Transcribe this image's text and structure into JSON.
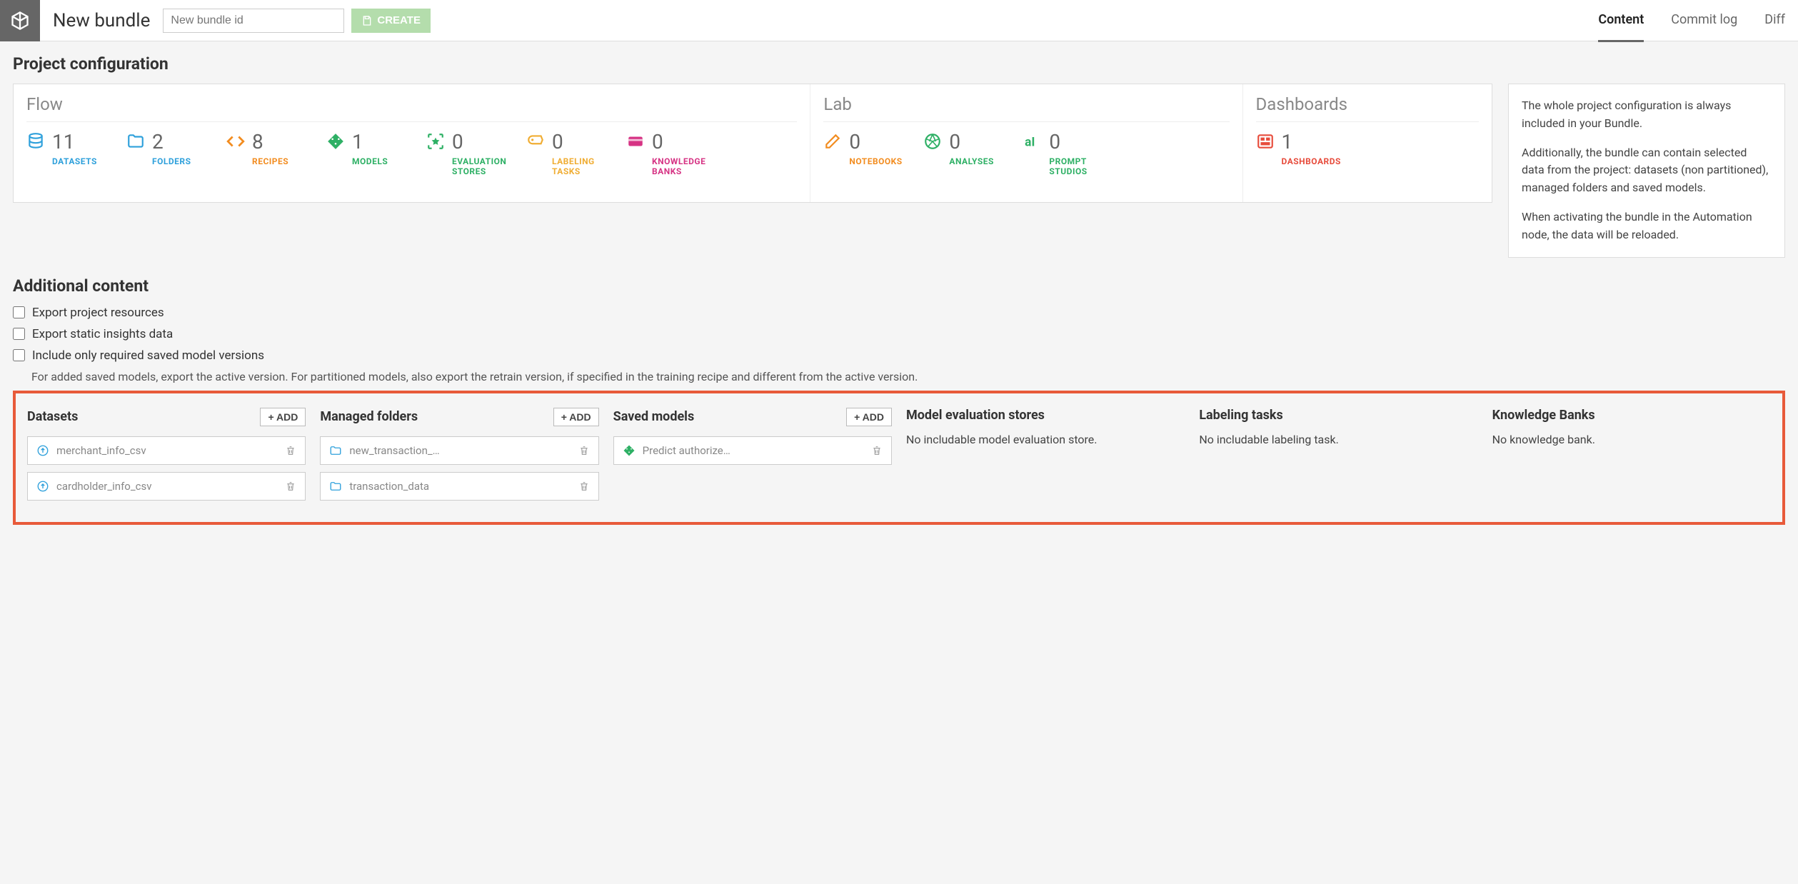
{
  "topbar": {
    "title": "New bundle",
    "bundle_id_placeholder": "New bundle id",
    "create_label": "CREATE",
    "tabs": [
      "Content",
      "Commit log",
      "Diff"
    ],
    "active_tab": 0
  },
  "sections": {
    "project_config_title": "Project configuration",
    "additional_content_title": "Additional content"
  },
  "config": {
    "flow_header": "Flow",
    "lab_header": "Lab",
    "dash_header": "Dashboards",
    "flow_stats": [
      {
        "count": "11",
        "label": "DATASETS",
        "color": "c-blue",
        "icon": "database"
      },
      {
        "count": "2",
        "label": "FOLDERS",
        "color": "c-blue",
        "icon": "folder"
      },
      {
        "count": "8",
        "label": "RECIPES",
        "color": "c-orange",
        "icon": "code"
      },
      {
        "count": "1",
        "label": "MODELS",
        "color": "c-green",
        "icon": "diamond"
      },
      {
        "count": "0",
        "label": "EVALUATION STORES",
        "color": "c-green",
        "icon": "star-box"
      },
      {
        "count": "0",
        "label": "LABELING TASKS",
        "color": "c-yellow",
        "icon": "tag"
      },
      {
        "count": "0",
        "label": "KNOWLEDGE BANKS",
        "color": "c-magenta",
        "icon": "card"
      }
    ],
    "lab_stats": [
      {
        "count": "0",
        "label": "NOTEBOOKS",
        "color": "c-orange",
        "icon": "edit"
      },
      {
        "count": "0",
        "label": "ANALYSES",
        "color": "c-green",
        "icon": "aperture"
      },
      {
        "count": "0",
        "label": "PROMPT STUDIOS",
        "color": "c-green",
        "icon": "ai"
      }
    ],
    "dash_stats": [
      {
        "count": "1",
        "label": "DASHBOARDS",
        "color": "c-red",
        "icon": "dashboard"
      }
    ]
  },
  "info": {
    "p1": "The whole project configuration is always included in your Bundle.",
    "p2": "Additionally, the bundle can contain selected data from the project: datasets (non partitioned), managed folders and saved models.",
    "p3": "When activating the bundle in the Automation node, the data will be reloaded."
  },
  "additional": {
    "check1": "Export project resources",
    "check2": "Export static insights data",
    "check3": "Include only required saved model versions",
    "check3_sub": "For added saved models, export the active version. For partitioned models, also export the retrain version, if specified in the training recipe and different from the active version."
  },
  "content_cols": {
    "add_label": "+ ADD",
    "datasets": {
      "title": "Datasets",
      "items": [
        "merchant_info_csv",
        "cardholder_info_csv"
      ]
    },
    "managed_folders": {
      "title": "Managed folders",
      "items": [
        "new_transaction_…",
        "transaction_data"
      ]
    },
    "saved_models": {
      "title": "Saved models",
      "items": [
        "Predict authorize…"
      ]
    },
    "eval_stores": {
      "title": "Model evaluation stores",
      "empty": "No includable model evaluation store."
    },
    "labeling": {
      "title": "Labeling tasks",
      "empty": "No includable labeling task."
    },
    "knowledge": {
      "title": "Knowledge Banks",
      "empty": "No knowledge bank."
    }
  }
}
